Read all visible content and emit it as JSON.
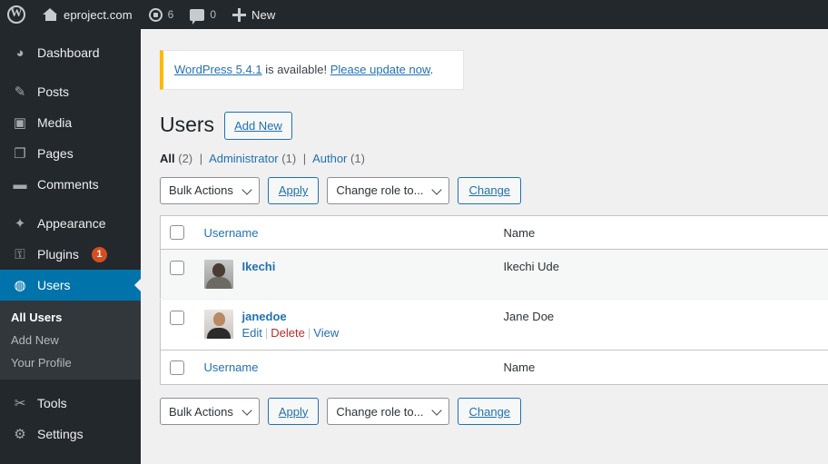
{
  "adminbar": {
    "logo_icon": "wordpress-logo-icon",
    "site_name": "eproject.com",
    "home_icon": "home-icon",
    "updates_icon": "updates-icon",
    "updates_count": "6",
    "comments_icon": "comments-icon",
    "comments_count": "0",
    "new_icon": "plus-icon",
    "new_label": "New"
  },
  "sidebar": {
    "items": [
      {
        "label": "Dashboard",
        "icon": "dashboard-icon",
        "glyph": "◕",
        "current": false
      },
      {
        "label": "Posts",
        "icon": "pin-icon",
        "glyph": "✎",
        "current": false
      },
      {
        "label": "Media",
        "icon": "media-icon",
        "glyph": "▣",
        "current": false
      },
      {
        "label": "Pages",
        "icon": "page-icon",
        "glyph": "❐",
        "current": false
      },
      {
        "label": "Comments",
        "icon": "comment-icon",
        "glyph": "▬",
        "current": false
      },
      {
        "label": "Appearance",
        "icon": "brush-icon",
        "glyph": "✦",
        "current": false
      },
      {
        "label": "Plugins",
        "icon": "plug-icon",
        "glyph": "⚿",
        "current": false,
        "badge": "1"
      },
      {
        "label": "Users",
        "icon": "user-icon",
        "glyph": "◍",
        "current": true
      },
      {
        "label": "Tools",
        "icon": "wrench-icon",
        "glyph": "✂",
        "current": false
      },
      {
        "label": "Settings",
        "icon": "settings-icon",
        "glyph": "⚙",
        "current": false
      }
    ],
    "submenu": [
      {
        "label": "All Users",
        "active": true
      },
      {
        "label": "Add New",
        "active": false
      },
      {
        "label": "Your Profile",
        "active": false
      }
    ]
  },
  "notice": {
    "link_version": "WordPress 5.4.1",
    "middle_text": " is available! ",
    "link_update": "Please update now",
    "end_text": ".",
    "accent_color": "#ffb900"
  },
  "page": {
    "title": "Users",
    "add_new_label": "Add New"
  },
  "filters": {
    "all_label": "All",
    "all_count": "(2)",
    "administrator_label": "Administrator",
    "administrator_count": "(1)",
    "author_label": "Author",
    "author_count": "(1)",
    "separator": "|"
  },
  "toolbar": {
    "bulk_actions_label": "Bulk Actions",
    "apply_label": "Apply",
    "change_role_label": "Change role to...",
    "change_label": "Change"
  },
  "table": {
    "columns": {
      "username": "Username",
      "name": "Name"
    },
    "rows": [
      {
        "username": "Ikechi",
        "name": "Ikechi Ude",
        "avatar": "user-avatar-photo",
        "actions": []
      },
      {
        "username": "janedoe",
        "name": "Jane Doe",
        "avatar": "user-avatar-photo",
        "actions": [
          {
            "label": "Edit",
            "kind": "edit"
          },
          {
            "label": "Delete",
            "kind": "delete"
          },
          {
            "label": "View",
            "kind": "view"
          }
        ]
      }
    ]
  },
  "colors": {
    "admin_bar": "#23282d",
    "sidebar": "#23282d",
    "current_menu": "#0073aa",
    "link": "#2271b1",
    "delete": "#b32d2e",
    "badge": "#d54e21",
    "notice_accent": "#ffb900"
  }
}
